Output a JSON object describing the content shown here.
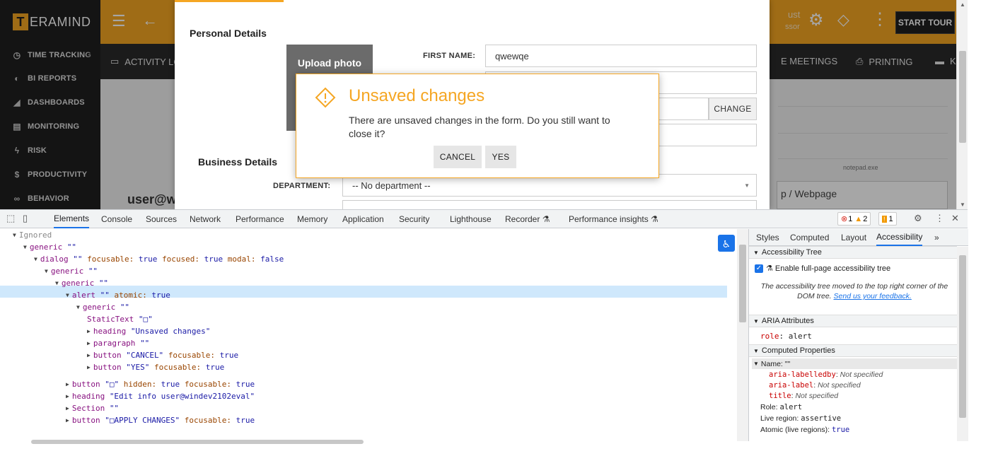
{
  "app": {
    "logo_letter": "T",
    "logo_rest": "ERAMIND",
    "start_tour": "START TOUR",
    "ghost_top_1": "ust",
    "ghost_top_2": "ssor"
  },
  "sidebar": {
    "items": [
      {
        "icon": "◷",
        "label": "TIME TRACKING"
      },
      {
        "icon": "◐",
        "label": "BI REPORTS"
      },
      {
        "icon": "◢",
        "label": "DASHBOARDS"
      },
      {
        "icon": "▤",
        "label": "MONITORING"
      },
      {
        "icon": "ϟ",
        "label": "RISK"
      },
      {
        "icon": "$",
        "label": "PRODUCTIVITY"
      },
      {
        "icon": "∞",
        "label": "BEHAVIOR"
      }
    ]
  },
  "subnav": {
    "activity_log": "ACTIVITY LO",
    "meetings": "E MEETINGS",
    "printing": "PRINTING",
    "more": "K"
  },
  "page": {
    "user_heading": "user@w",
    "notepad": "notepad.exe",
    "webpage": "p / Webpage"
  },
  "form": {
    "personal_details": "Personal Details",
    "business_details": "Business Details",
    "upload_photo": "Upload photo",
    "first_name_label": "FIRST NAME:",
    "first_name_value": "qwewqe",
    "change_label": "CHANGE",
    "department_label": "DEPARTMENT:",
    "department_value": "-- No department --"
  },
  "alert": {
    "title": "Unsaved changes",
    "text": "There are unsaved changes in the form. Do you still want to close it?",
    "cancel": "CANCEL",
    "yes": "YES"
  },
  "devtools": {
    "tabs": [
      "Elements",
      "Console",
      "Sources",
      "Network",
      "Performance",
      "Memory",
      "Application",
      "Security",
      "Lighthouse",
      "Recorder ⚗",
      "Performance insights ⚗"
    ],
    "active_tab": "Elements",
    "errors": "1",
    "warnings": "2",
    "issues": "1",
    "tree": [
      {
        "indent": 0,
        "tri": "▼",
        "role": "Ignored",
        "ignored": true
      },
      {
        "indent": 1,
        "tri": "▼",
        "role": "generic",
        "name": "\"\""
      },
      {
        "indent": 2,
        "tri": "▼",
        "role": "dialog",
        "name": "\"\"",
        "props": "focusable: true focused: true modal: false"
      },
      {
        "indent": 3,
        "tri": "▼",
        "role": "generic",
        "name": "\"\""
      },
      {
        "indent": 4,
        "tri": "▼",
        "role": "generic",
        "name": "\"\""
      },
      {
        "indent": 5,
        "tri": "▼",
        "role": "alert",
        "name": "\"\"",
        "props": "atomic: true"
      },
      {
        "indent": 6,
        "tri": "▼",
        "role": "generic",
        "name": "\"\""
      },
      {
        "indent": 7,
        "tri": "",
        "role": "StaticText",
        "name": "\"□\""
      },
      {
        "indent": 7,
        "tri": "▶",
        "role": "heading",
        "name": "\"Unsaved changes\""
      },
      {
        "indent": 7,
        "tri": "▶",
        "role": "paragraph",
        "name": "\"\""
      },
      {
        "indent": 7,
        "tri": "▶",
        "role": "button",
        "name": "\"CANCEL\"",
        "props": "focusable: true"
      },
      {
        "indent": 7,
        "tri": "▶",
        "role": "button",
        "name": "\"YES\"",
        "props": "focusable: true"
      },
      {
        "indent": 5,
        "tri": "▶",
        "role": "button",
        "name": "\"□\"",
        "props": "hidden: true focusable: true"
      },
      {
        "indent": 5,
        "tri": "▶",
        "role": "heading",
        "name": "\"Edit info user@windev2102eval\""
      },
      {
        "indent": 5,
        "tri": "▶",
        "role": "Section",
        "name": "\"\""
      },
      {
        "indent": 5,
        "tri": "▶",
        "role": "button",
        "name": "\"□APPLY CHANGES\"",
        "props": "focusable: true"
      }
    ],
    "side_tabs": [
      "Styles",
      "Computed",
      "Layout",
      "Accessibility",
      "»"
    ],
    "side_active": "Accessibility",
    "a11y_tree_header": "Accessibility Tree",
    "enable_full_page": "Enable full-page accessibility tree",
    "moved_note": "The accessibility tree moved to the top right corner of the DOM tree.",
    "feedback_link": "Send us your feedback.",
    "aria_header": "ARIA Attributes",
    "aria_role_key": "role",
    "aria_role_value": "alert",
    "computed_header": "Computed Properties",
    "name_row": "Name: \"\"",
    "labelledby_key": "aria-labelledby",
    "labelledby_val": "Not specified",
    "label_key": "aria-label",
    "label_val": "Not specified",
    "title_key": "title",
    "title_val": "Not specified",
    "role_key": "Role",
    "role_val": "alert",
    "live_key": "Live region",
    "live_val": "assertive",
    "atomic_key": "Atomic (live regions)",
    "atomic_val": "true"
  }
}
